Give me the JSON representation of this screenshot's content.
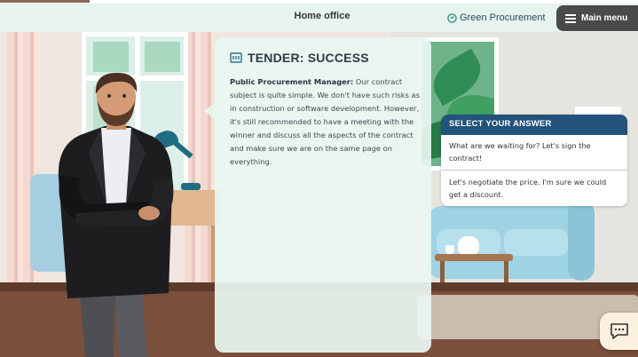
{
  "header": {
    "title": "Home office",
    "brand": "Green Procurement",
    "menu_label": "Main menu",
    "progress_fraction": 0.14
  },
  "dialogue": {
    "title": "TENDER: SUCCESS",
    "speaker": "Public Procurement Manager:",
    "text": " Our contract subject is quite simple. We don't have such risks as in construction or software development. However, it's still recommended to have a meeting with the winner and discuss all the aspects of the contract and make sure we are on the same page on everything."
  },
  "answers": {
    "heading": "SELECT YOUR ANSWER",
    "options": [
      {
        "label": "What are we waiting for? Let's sign the contract!"
      },
      {
        "label": "Let's negotiate the price. I'm sure we could get a discount."
      }
    ]
  },
  "icons": {
    "brand": "recycle-leaf-icon",
    "menu": "hamburger-icon",
    "panel": "document-icon",
    "chat": "chat-bubble-icon"
  },
  "colors": {
    "accent": "#23527a",
    "menu_bg": "#4a4a4a",
    "topbar_bg": "#e6f3ef",
    "panel_bg": "#eaf6f1"
  }
}
